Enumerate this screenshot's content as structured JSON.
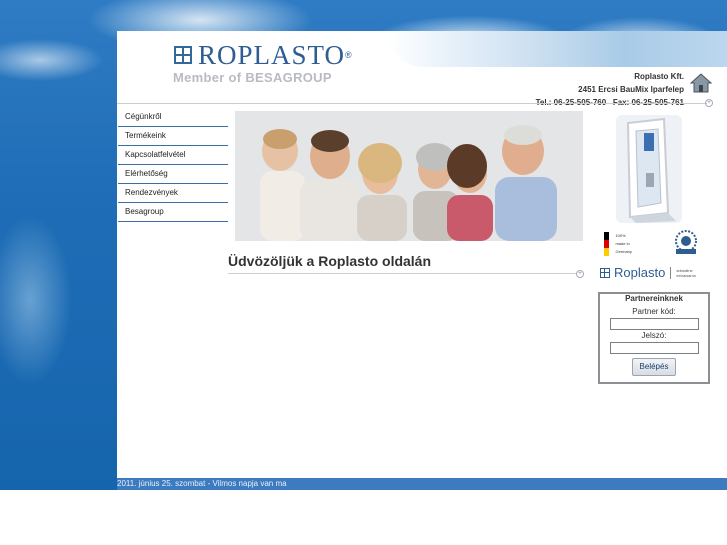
{
  "header": {
    "logo_text": "ROPLASTO",
    "logo_reg": "®",
    "tagline": "Member of BESAGROUP",
    "company_name": "Roplasto Kft.",
    "address": "2451 Ercsi BauMix Iparfelep",
    "phone": "Tel.: 06-25-505-760",
    "fax": "Fax: 06-25-505-761"
  },
  "nav": {
    "items": [
      {
        "label": "Cégünkről"
      },
      {
        "label": "Termékeink"
      },
      {
        "label": "Kapcsolatfelvétel"
      },
      {
        "label": "Elérhetőség"
      },
      {
        "label": "Rendezvények"
      },
      {
        "label": "Besagroup"
      }
    ]
  },
  "main": {
    "title": "Üdvözöljük a Roplasto oldalán"
  },
  "side": {
    "made_in_lines": [
      "100%",
      "made in",
      "Germany"
    ],
    "brand_text": "Roplasto",
    "brand_sub_1": "arbdaline",
    "brand_sub_2": "extrawaros"
  },
  "partner": {
    "legend": "Partnereinknek",
    "code_label": "Partner kód:",
    "password_label": "Jelszó:",
    "login_button": "Belépés",
    "code_value": "",
    "password_value": ""
  },
  "footer": {
    "text": "2011. június 25. szombat - Vilmos napja van ma"
  },
  "colors": {
    "accent": "#2e5d92",
    "nav_rule": "#3a6ea5",
    "footer_bar": "#3d7bc0",
    "sky": "#1f6db6"
  }
}
